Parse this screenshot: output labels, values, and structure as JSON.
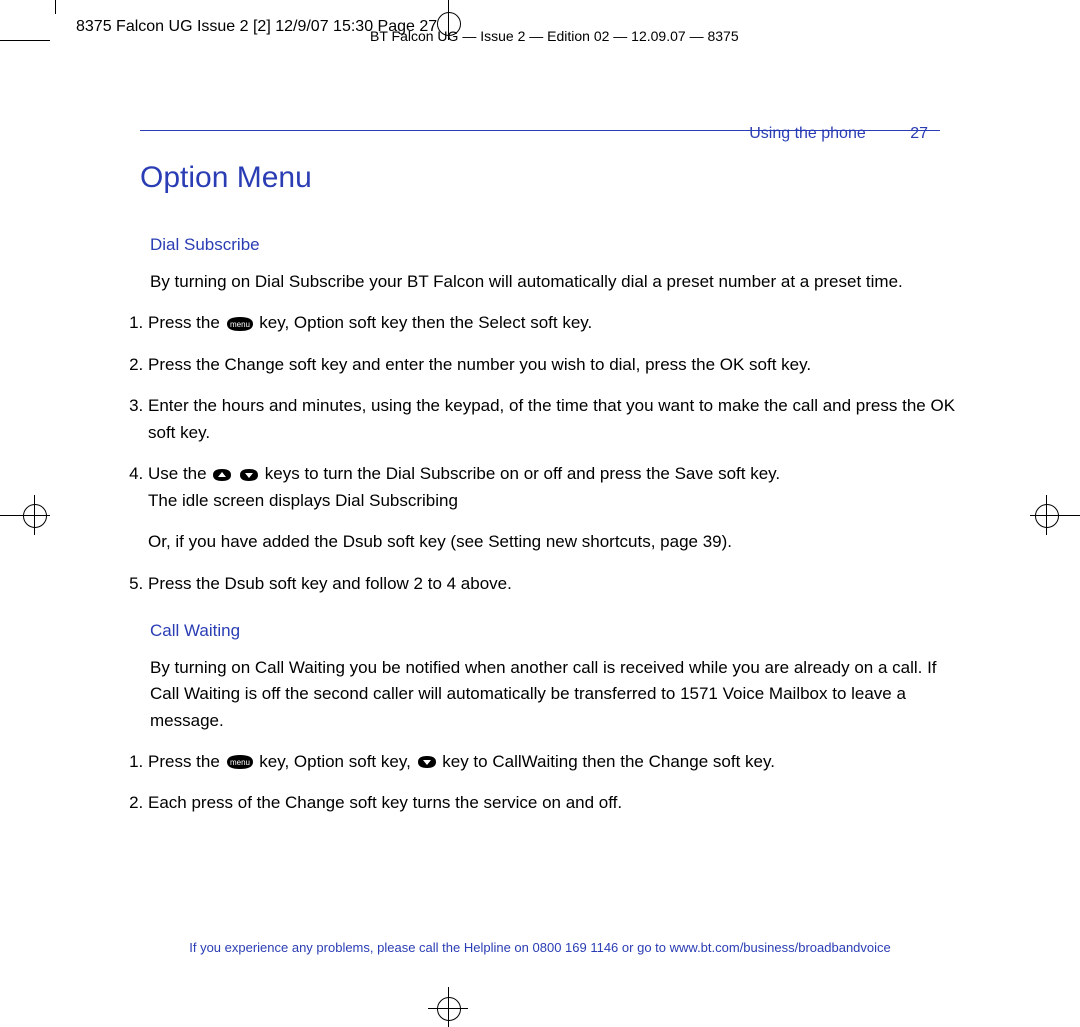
{
  "slug": "8375 Falcon UG Issue 2 [2]  12/9/07  15:30  Page 27",
  "header_line": "BT Falcon UG — Issue 2 — Edition 02 — 12.09.07 — 8375",
  "running_head": {
    "section": "Using the phone",
    "page": "27"
  },
  "title": "Option Menu",
  "dial_subscribe": {
    "heading": "Dial Subscribe",
    "intro": "By turning on Dial Subscribe your BT Falcon will automatically dial a preset number at a preset time.",
    "s1_a": "Press the ",
    "s1_b": " key, ",
    "s1_c": "Option",
    "s1_d": " soft key then the ",
    "s1_e": "Select",
    "s1_f": " soft key.",
    "s2_a": "Press the ",
    "s2_b": "Change",
    "s2_c": " soft key and enter the number you wish to dial, press the ",
    "s2_d": "OK",
    "s2_e": " soft key.",
    "s3_a": "Enter the hours and minutes, using the keypad, of the time that you want to make the call and press the ",
    "s3_b": "OK",
    "s3_c": " soft key.",
    "s4_a": "Use the ",
    "s4_b": " keys to turn the Dial Subscribe on or off and press the ",
    "s4_c": "Save",
    "s4_d": " soft key.",
    "s4_e": "The idle screen displays ",
    "s4_f": "Dial Subscribing",
    "s4_or_a": "Or, if you have added the ",
    "s4_or_b": "Dsub",
    "s4_or_c": " soft key (see Setting new shortcuts, page 39).",
    "s5_a": "Press the ",
    "s5_b": "Dsub",
    "s5_c": " soft key and follow 2 to 4 above."
  },
  "call_waiting": {
    "heading": "Call Waiting",
    "intro": "By turning on Call Waiting you be notified when another call is received while you are already on a call. If Call Waiting is off the second caller will automatically be transferred to 1571 Voice Mailbox to leave a message.",
    "s1_a": "Press the ",
    "s1_b": " key, ",
    "s1_c": "Option",
    "s1_d": " soft key, ",
    "s1_e": " key to ",
    "s1_f": "CallWaiting",
    "s1_g": " then the ",
    "s1_h": "Change",
    "s1_i": " soft key.",
    "s2_a": "Each press of the ",
    "s2_b": "Change",
    "s2_c": " soft key turns the service on and off."
  },
  "footer_a": "If you experience any problems, please call the Helpline on ",
  "footer_b": "0800 169 1146",
  "footer_c": " or go to ",
  "footer_d": "www.bt.com/business/broadbandvoice"
}
